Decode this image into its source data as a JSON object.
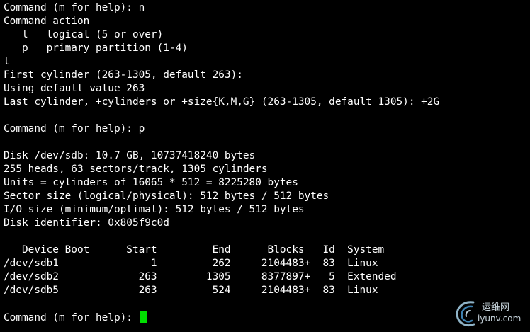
{
  "terminal": {
    "background_color": "#000000",
    "text_color": "#ffffff",
    "cursor_color": "#00e000",
    "lines": [
      "Command (m for help): n",
      "Command action",
      "   l   logical (5 or over)",
      "   p   primary partition (1-4)",
      "l",
      "First cylinder (263-1305, default 263):",
      "Using default value 263",
      "Last cylinder, +cylinders or +size{K,M,G} (263-1305, default 1305): +2G",
      "",
      "Command (m for help): p",
      "",
      "Disk /dev/sdb: 10.7 GB, 10737418240 bytes",
      "255 heads, 63 sectors/track, 1305 cylinders",
      "Units = cylinders of 16065 * 512 = 8225280 bytes",
      "Sector size (logical/physical): 512 bytes / 512 bytes",
      "I/O size (minimum/optimal): 512 bytes / 512 bytes",
      "Disk identifier: 0x805f9c0d",
      "",
      "   Device Boot      Start         End      Blocks   Id  System",
      "/dev/sdb1               1         262     2104483+  83  Linux",
      "/dev/sdb2             263        1305     8377897+   5  Extended",
      "/dev/sdb5             263         524     2104483+  83  Linux",
      ""
    ],
    "prompt": "Command (m for help): "
  },
  "watermark": {
    "title": "运维网",
    "domain": "iyunv.com",
    "icon": "swirl-logo-icon"
  }
}
